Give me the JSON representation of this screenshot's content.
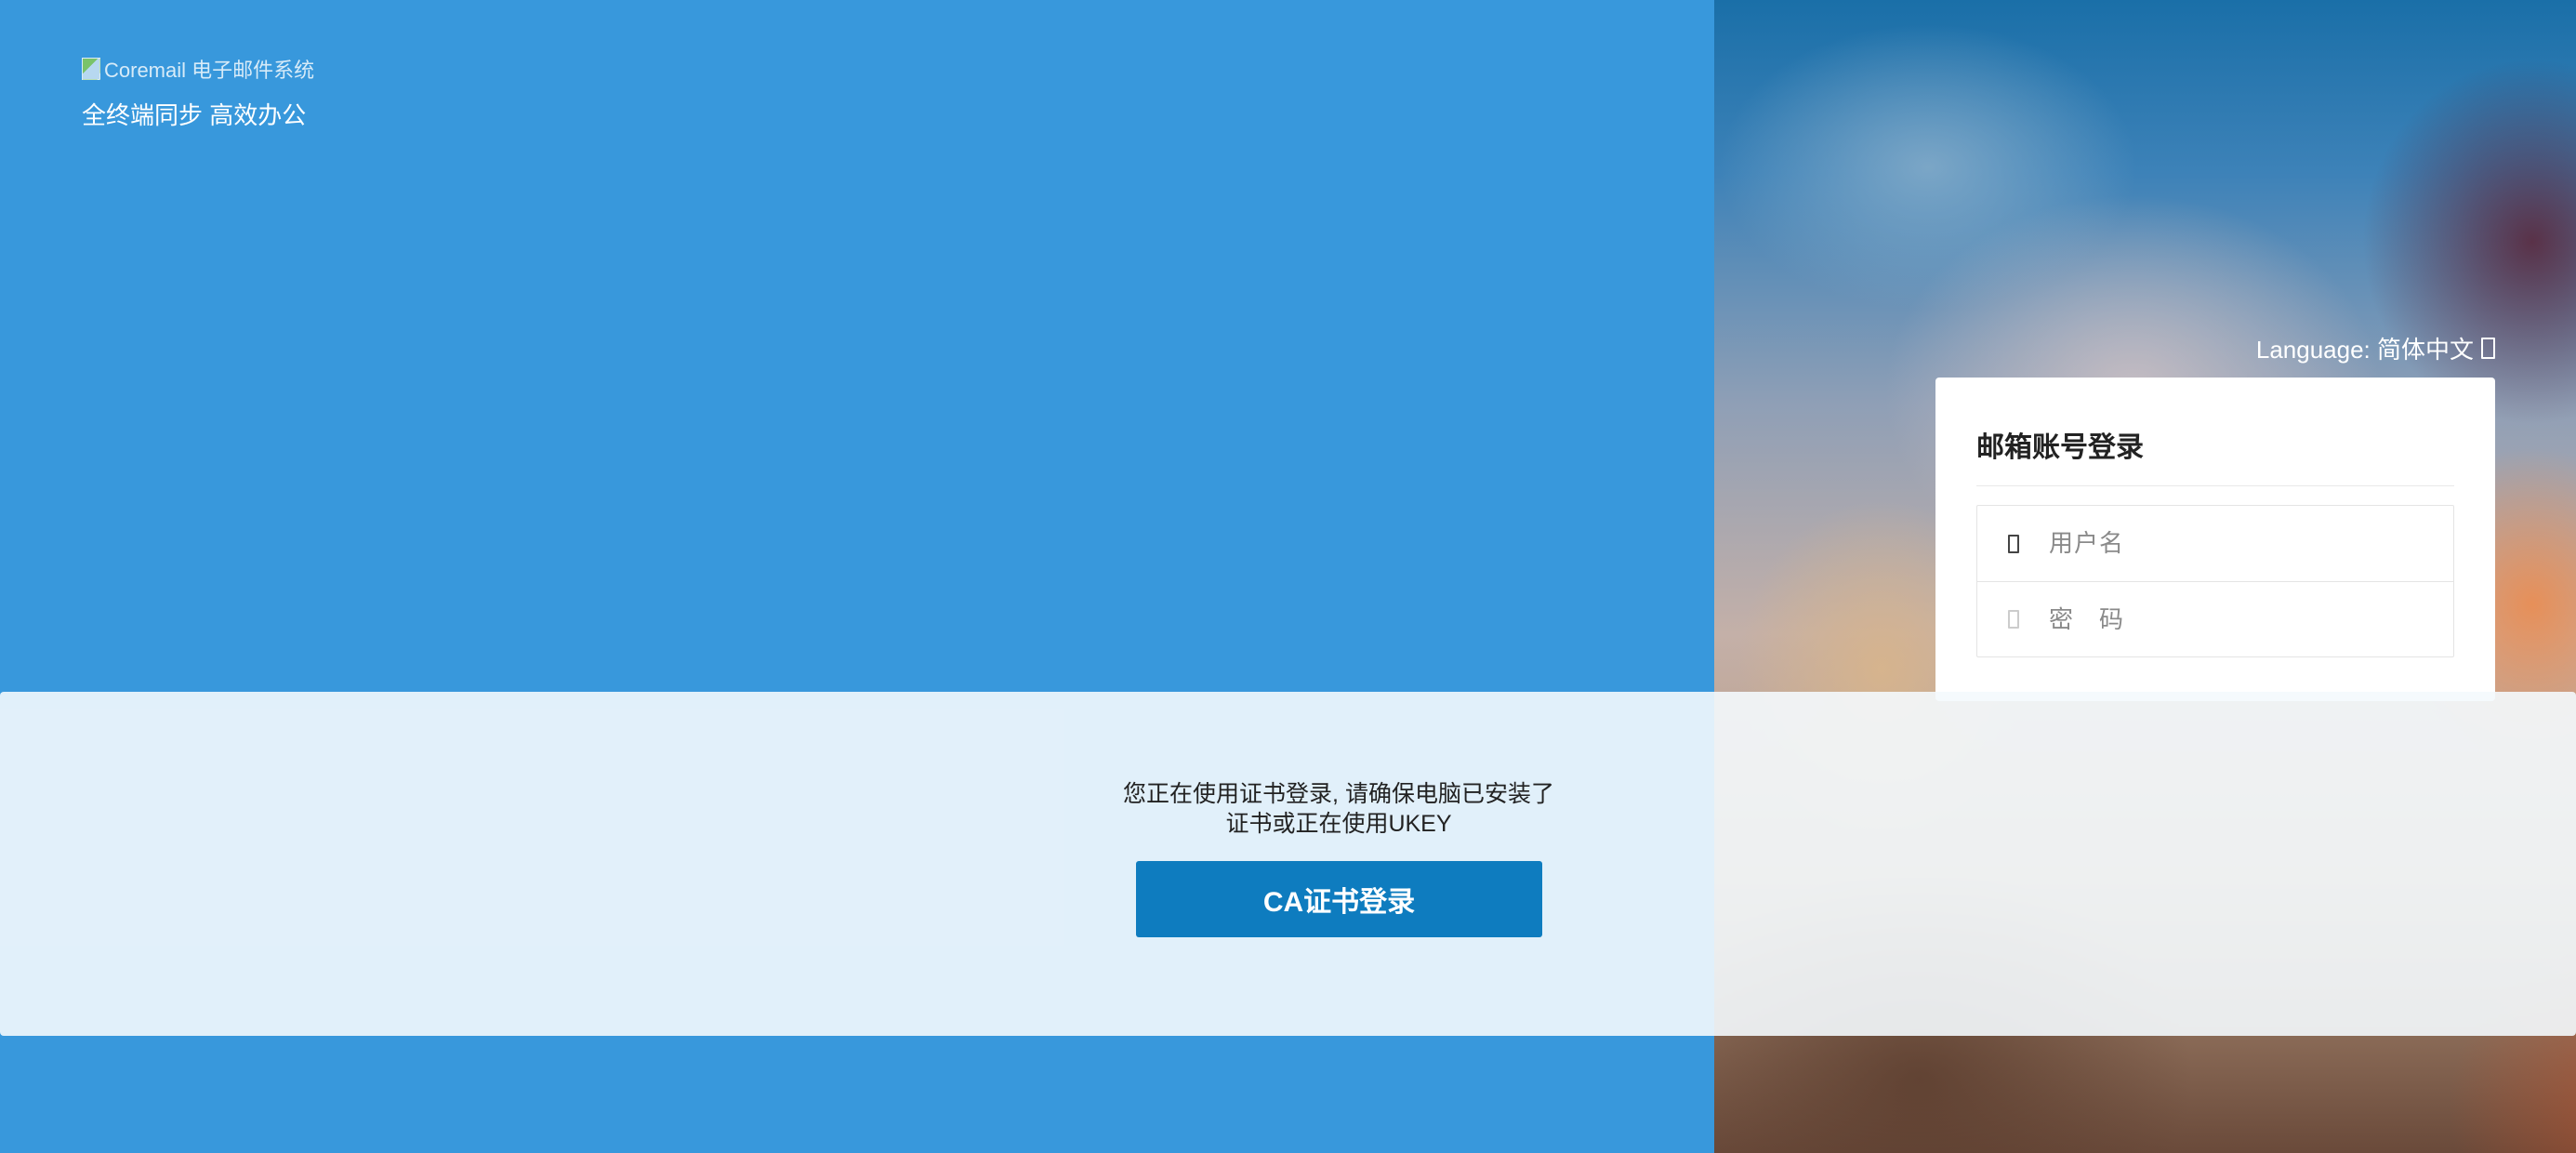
{
  "header": {
    "logo_alt": "Coremail 电子邮件系统",
    "slogan": "全终端同步 高效办公"
  },
  "language": {
    "label": "Language: 简体中文",
    "icon": "chevron-down-icon"
  },
  "login": {
    "title": "邮箱账号登录",
    "username_placeholder": "用户名",
    "password_placeholder": "密　码",
    "username_icon": "user-icon",
    "password_icon": "lock-icon"
  },
  "ca": {
    "message": "您正在使用证书登录, 请确保电脑已安装了证书或正在使用UKEY",
    "button_label": "CA证书登录"
  },
  "colors": {
    "left_background": "#3898dc",
    "ca_button": "#0e7cbf",
    "card_background": "#ffffff"
  }
}
